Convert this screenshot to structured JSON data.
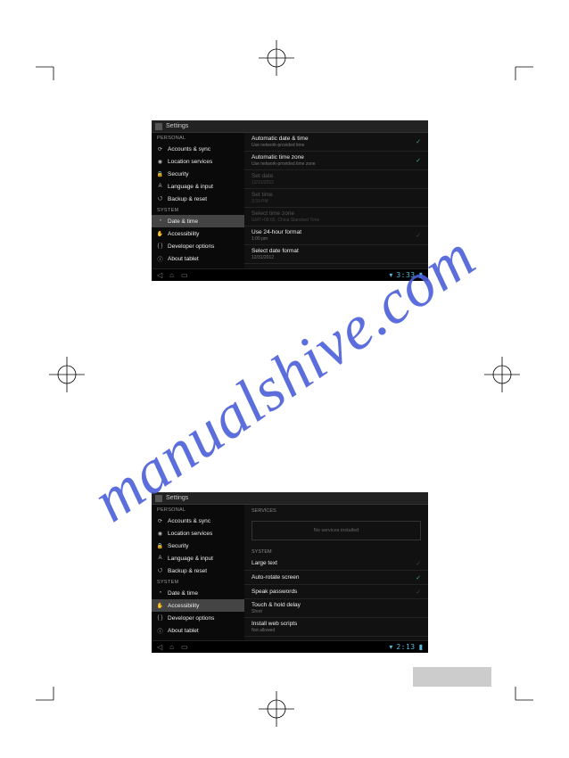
{
  "watermark": "manualshive.com",
  "settings_title": "Settings",
  "personal_header": "PERSONAL",
  "system_header": "SYSTEM",
  "sidebar": {
    "accounts": "Accounts & sync",
    "location": "Location services",
    "security": "Security",
    "language": "Language & input",
    "backup": "Backup & reset",
    "datetime": "Date & time",
    "accessibility": "Accessibility",
    "developer": "Developer options",
    "about": "About tablet"
  },
  "screen1": {
    "auto_date": {
      "title": "Automatic date & time",
      "sub": "Use network-provided time"
    },
    "auto_tz": {
      "title": "Automatic time zone",
      "sub": "Use network-provided time zone"
    },
    "set_date": {
      "title": "Set date",
      "sub": "12/31/2012"
    },
    "set_time": {
      "title": "Set time",
      "sub": "3:33 PM"
    },
    "sel_tz": {
      "title": "Select time zone",
      "sub": "GMT+08:00, China Standard Time"
    },
    "use24": {
      "title": "Use 24-hour format",
      "sub": "1:00 pm"
    },
    "datefmt": {
      "title": "Select date format",
      "sub": "12/31/2012"
    },
    "clock": "3:33"
  },
  "screen2": {
    "services_header": "SERVICES",
    "no_services": "No services installed",
    "system_header": "SYSTEM",
    "large_text": "Large text",
    "auto_rotate": "Auto-rotate screen",
    "speak_pw": "Speak passwords",
    "touch_hold": {
      "title": "Touch & hold delay",
      "sub": "Short"
    },
    "webscripts": {
      "title": "Install web scripts",
      "sub": "Not allowed"
    },
    "clock": "2:13"
  }
}
